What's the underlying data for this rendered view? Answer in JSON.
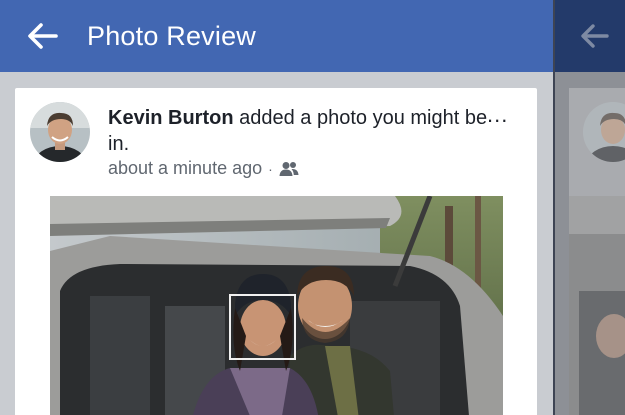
{
  "header": {
    "title": "Photo Review",
    "back_icon": "arrow-left-icon",
    "color": "#4267b2"
  },
  "post": {
    "author": "Kevin Burton",
    "action": " added a photo you might be in.",
    "timestamp": "about a minute ago",
    "separator": "·",
    "privacy_icon": "friends-icon",
    "more_label": "..."
  },
  "photo": {
    "subject": "car-trunk-couple",
    "face_tag": "face-highlight"
  }
}
